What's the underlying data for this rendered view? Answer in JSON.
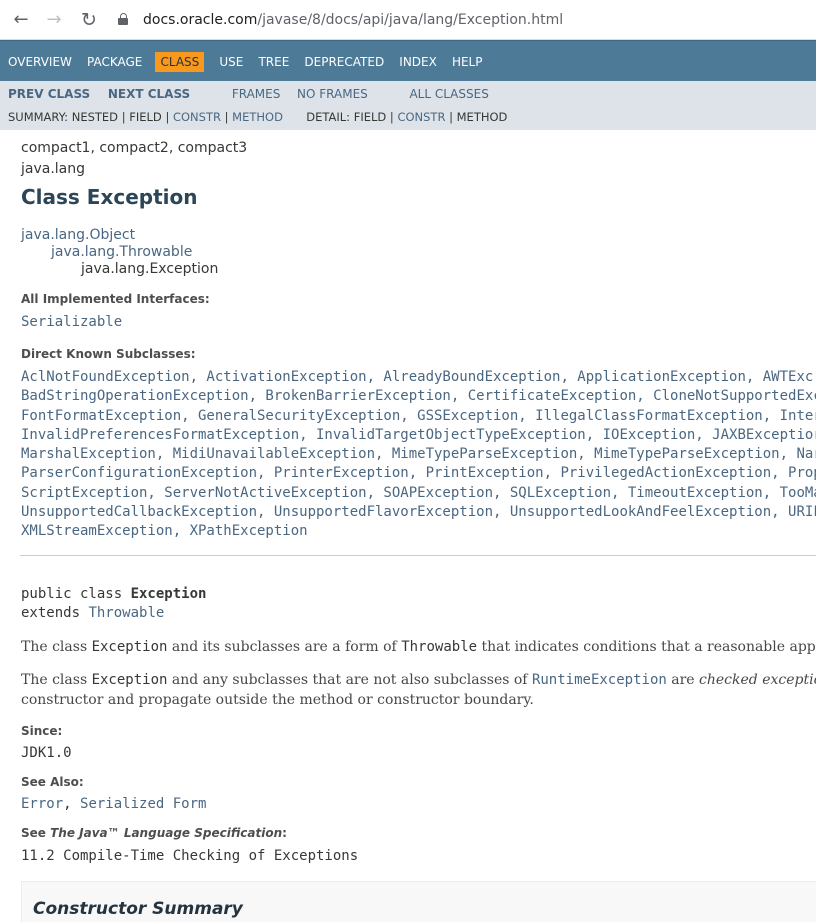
{
  "browser": {
    "host": "docs.oracle.com",
    "path": "/javase/8/docs/api/java/lang/Exception.html"
  },
  "topnav": {
    "items": [
      "Overview",
      "Package",
      "Class",
      "Use",
      "Tree",
      "Deprecated",
      "Index",
      "Help"
    ],
    "active": "Class"
  },
  "subnav": {
    "prev": "Prev Class",
    "next": "Next Class",
    "frames": "Frames",
    "noframes": "No Frames",
    "allclasses": "All Classes",
    "summary_label": "Summary:",
    "summary_nested": "Nested",
    "summary_field": "Field",
    "summary_constr": "Constr",
    "summary_method": "Method",
    "detail_label": "Detail:",
    "detail_field": "Field",
    "detail_constr": "Constr",
    "detail_method": "Method",
    "sep": "|"
  },
  "header": {
    "profiles": "compact1, compact2, compact3",
    "package": "java.lang",
    "title": "Class Exception"
  },
  "inheritance": [
    "java.lang.Object",
    "java.lang.Throwable",
    "java.lang.Exception"
  ],
  "interfaces": {
    "label": "All Implemented Interfaces:",
    "value": "Serializable"
  },
  "subclasses": {
    "label": "Direct Known Subclasses:",
    "lines": [
      "AclNotFoundException, ActivationException, AlreadyBoundException, ApplicationException, AWTExc",
      "BadStringOperationException, BrokenBarrierException, CertificateException, CloneNotSupportedExc",
      "FontFormatException, GeneralSecurityException, GSSException, IllegalClassFormatException, Inter",
      "InvalidPreferencesFormatException, InvalidTargetObjectTypeException, IOException, JAXBExceptior",
      "MarshalException, MidiUnavailableException, MimeTypeParseException, MimeTypeParseException, Nar",
      "ParserConfigurationException, PrinterException, PrintException, PrivilegedActionException, Prop",
      "ScriptException, ServerNotActiveException, SOAPException, SQLException, TimeoutException, TooMa",
      "UnsupportedCallbackException, UnsupportedFlavorException, UnsupportedLookAndFeelException, URIF",
      "XMLStreamException, XPathException"
    ]
  },
  "declaration": {
    "line1_prefix": "public class ",
    "line1_name": "Exception",
    "line2_prefix": "extends ",
    "line2_link": "Throwable"
  },
  "description": {
    "p1_a": "The class ",
    "p1_code": "Exception",
    "p1_b": " and its subclasses are a form of ",
    "p1_code2": "Throwable",
    "p1_c": " that indicates conditions that a reasonable app",
    "p2_a": "The class ",
    "p2_code": "Exception",
    "p2_b": " and any subclasses that are not also subclasses of ",
    "p2_link": "RuntimeException",
    "p2_c": " are ",
    "p2_em": "checked exceptio",
    "p2_line2": "constructor and propagate outside the method or constructor boundary."
  },
  "since": {
    "label": "Since:",
    "value": "JDK1.0"
  },
  "see_also": {
    "label": "See Also:",
    "link1": "Error",
    "sep": ", ",
    "link2": "Serialized Form"
  },
  "jls": {
    "label_a": "See ",
    "label_em": "The Java™ Language Specification",
    "label_b": ":",
    "value": "11.2 Compile-Time Checking of Exceptions"
  },
  "constructor_summary": {
    "title": "Constructor Summary"
  }
}
